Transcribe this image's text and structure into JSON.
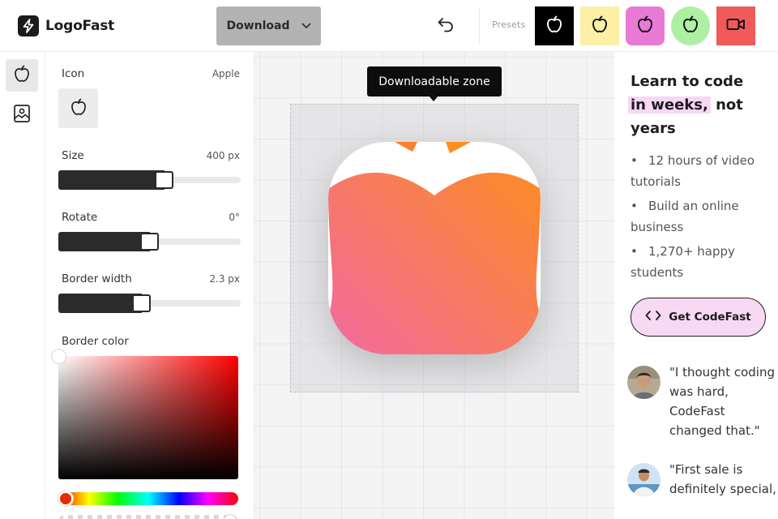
{
  "app": {
    "name": "LogoFast",
    "download_label": "Download",
    "presets_label": "Presets",
    "presets": [
      {
        "name": "black",
        "bg": "#000000",
        "fg": "#ffffff"
      },
      {
        "name": "yellow",
        "bg": "#fdf0a6",
        "fg": "#111111"
      },
      {
        "name": "pink",
        "bg": "#e87ad6",
        "fg": "#111111"
      },
      {
        "name": "green",
        "bg": "#aef0a2",
        "fg": "#111111"
      },
      {
        "name": "red",
        "bg": "#f05a5a",
        "fg": "#111111"
      }
    ]
  },
  "panel": {
    "icon_label": "Icon",
    "icon_value": "Apple",
    "size_label": "Size",
    "size_value": "400 px",
    "size_fraction": 0.59,
    "rotate_label": "Rotate",
    "rotate_value": "0°",
    "rotate_fraction": 0.5,
    "border_width_label": "Border width",
    "border_width_value": "2.3 px",
    "border_width_fraction": 0.45,
    "border_color_label": "Border color",
    "border_color_value": "#ffffff"
  },
  "canvas": {
    "tooltip": "Downloadable zone",
    "gradient_start": "#f26aa0",
    "gradient_end": "#fd8d1c"
  },
  "promo": {
    "heading_part1": "Learn to code",
    "heading_highlight": "in weeks,",
    "heading_part2": " not years",
    "bullets": [
      "12 hours of video tutorials",
      "Build an online business",
      "1,270+ happy students"
    ],
    "cta_label": "Get CodeFast",
    "testimonials": [
      {
        "quote": "\"I thought coding was hard, CodeFast changed that.\""
      },
      {
        "quote": "\"First sale is definitely special,"
      }
    ]
  },
  "icons": {
    "logo": "lightning-icon",
    "download_chevron": "chevron-down-icon",
    "undo": "undo-icon",
    "rail_icon_tab": "apple-icon",
    "rail_background_tab": "image-icon",
    "cta_icon": "code-icon"
  }
}
